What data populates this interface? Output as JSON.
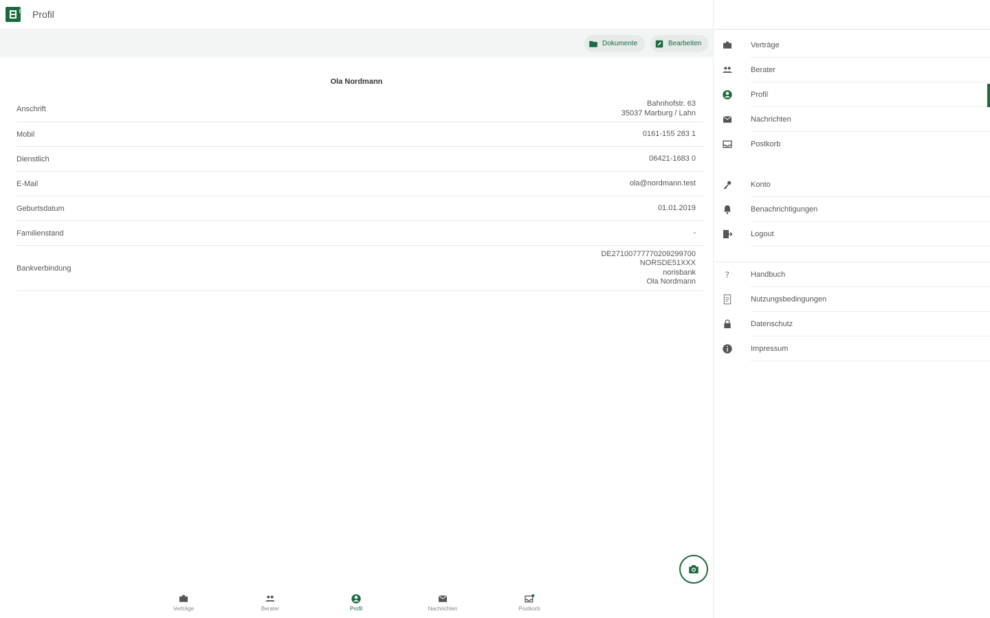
{
  "header": {
    "title": "Profil"
  },
  "toolbar": {
    "documents_label": "Dokumente",
    "edit_label": "Bearbeiten"
  },
  "profile": {
    "name": "Ola Nordmann",
    "rows": [
      {
        "label": "Anschrift",
        "value": [
          "Bahnhofstr. 63",
          "35037 Marburg / Lahn"
        ]
      },
      {
        "label": "Mobil",
        "value": [
          "0161-155 283 1"
        ]
      },
      {
        "label": "Dienstlich",
        "value": [
          "06421-1683 0"
        ]
      },
      {
        "label": "E-Mail",
        "value": [
          "ola@nordmann.test"
        ]
      },
      {
        "label": "Geburtsdatum",
        "value": [
          "01.01.2019"
        ]
      },
      {
        "label": "Familienstand",
        "value": [
          "-"
        ]
      },
      {
        "label": "Bankverbindung",
        "value": [
          "DE27100777770209299700",
          "NORSDE51XXX",
          "norisbank",
          "Ola Nordmann"
        ]
      }
    ]
  },
  "bottom_nav": [
    {
      "label": "Verträge",
      "icon": "briefcase-icon"
    },
    {
      "label": "Berater",
      "icon": "people-icon"
    },
    {
      "label": "Profil",
      "icon": "account-circle-icon",
      "active": true
    },
    {
      "label": "Nachrichten",
      "icon": "mail-icon"
    },
    {
      "label": "Postkorb",
      "icon": "inbox-icon"
    }
  ],
  "sidebar": {
    "group1": [
      {
        "label": "Verträge",
        "icon": "briefcase-icon"
      },
      {
        "label": "Berater",
        "icon": "people-icon"
      },
      {
        "label": "Profil",
        "icon": "account-circle-icon",
        "active": true
      },
      {
        "label": "Nachrichten",
        "icon": "mail-icon"
      },
      {
        "label": "Postkorb",
        "icon": "inbox-icon"
      }
    ],
    "group2": [
      {
        "label": "Konto",
        "icon": "key-icon"
      },
      {
        "label": "Benachrichtigungen",
        "icon": "bell-icon"
      },
      {
        "label": "Logout",
        "icon": "logout-icon"
      }
    ],
    "group3": [
      {
        "label": "Handbuch",
        "icon": "help-icon"
      },
      {
        "label": "Nutzungsbedingungen",
        "icon": "document-icon"
      },
      {
        "label": "Datenschutz",
        "icon": "lock-icon"
      },
      {
        "label": "Impressum",
        "icon": "info-icon"
      }
    ]
  },
  "colors": {
    "accent": "#1a6b3e",
    "toolbar_bg": "#f3f4f4"
  }
}
